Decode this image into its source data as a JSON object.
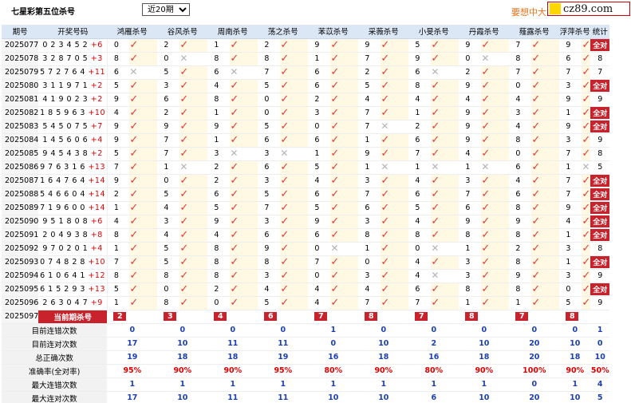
{
  "title": "七星彩第五位杀号",
  "period_select": {
    "value": "近20期",
    "options": [
      "近20期"
    ]
  },
  "ad_text": "要想中大",
  "logo_text": "cz89.com",
  "headers": [
    "期号",
    "开奖号码",
    "鸿雁杀号",
    "谷风杀号",
    "周南杀号",
    "荡之杀号",
    "苯苡杀号",
    "采薇杀号",
    "小旻杀号",
    "丹霞杀号",
    "薤露杀号",
    "浮萍杀号",
    "统计"
  ],
  "rows": [
    {
      "period": "2025077",
      "digits": "023452",
      "sum": "+6",
      "kills": [
        [
          "0",
          "ok"
        ],
        [
          "2",
          "ok"
        ],
        [
          "1",
          "ok"
        ],
        [
          "2",
          "ok"
        ],
        [
          "9",
          "ok"
        ],
        [
          "9",
          "ok"
        ],
        [
          "5",
          "ok"
        ],
        [
          "9",
          "ok"
        ],
        [
          "7",
          "ok"
        ],
        [
          "9",
          "ok"
        ]
      ],
      "stat": "全对"
    },
    {
      "period": "2025078",
      "digits": "328705",
      "sum": "+3",
      "kills": [
        [
          "8",
          "ok"
        ],
        [
          "0",
          "bad"
        ],
        [
          "8",
          "ok"
        ],
        [
          "8",
          "ok"
        ],
        [
          "1",
          "ok"
        ],
        [
          "7",
          "ok"
        ],
        [
          "9",
          "ok"
        ],
        [
          "0",
          "bad"
        ],
        [
          "8",
          "ok"
        ],
        [
          "6",
          "ok"
        ]
      ],
      "stat": "8"
    },
    {
      "period": "2025079",
      "digits": "572764",
      "sum": "+11",
      "kills": [
        [
          "6",
          "bad"
        ],
        [
          "5",
          "ok"
        ],
        [
          "6",
          "bad"
        ],
        [
          "7",
          "ok"
        ],
        [
          "6",
          "ok"
        ],
        [
          "2",
          "ok"
        ],
        [
          "6",
          "bad"
        ],
        [
          "2",
          "ok"
        ],
        [
          "7",
          "ok"
        ],
        [
          "7",
          "ok"
        ]
      ],
      "stat": "7"
    },
    {
      "period": "2025080",
      "digits": "311971",
      "sum": "+2",
      "kills": [
        [
          "5",
          "ok"
        ],
        [
          "3",
          "ok"
        ],
        [
          "4",
          "ok"
        ],
        [
          "5",
          "ok"
        ],
        [
          "6",
          "ok"
        ],
        [
          "5",
          "ok"
        ],
        [
          "8",
          "ok"
        ],
        [
          "9",
          "ok"
        ],
        [
          "0",
          "ok"
        ],
        [
          "3",
          "ok"
        ]
      ],
      "stat": "全对"
    },
    {
      "period": "2025081",
      "digits": "419023",
      "sum": "+2",
      "kills": [
        [
          "9",
          "ok"
        ],
        [
          "6",
          "ok"
        ],
        [
          "8",
          "ok"
        ],
        [
          "0",
          "ok"
        ],
        [
          "2",
          "ok"
        ],
        [
          "4",
          "ok"
        ],
        [
          "4",
          "ok"
        ],
        [
          "4",
          "ok"
        ],
        [
          "4",
          "ok"
        ],
        [
          "9",
          "ok"
        ]
      ],
      "stat": "9"
    },
    {
      "period": "2025082",
      "digits": "185963",
      "sum": "+10",
      "kills": [
        [
          "4",
          "ok"
        ],
        [
          "2",
          "ok"
        ],
        [
          "1",
          "ok"
        ],
        [
          "0",
          "ok"
        ],
        [
          "3",
          "ok"
        ],
        [
          "7",
          "ok"
        ],
        [
          "1",
          "ok"
        ],
        [
          "9",
          "ok"
        ],
        [
          "3",
          "ok"
        ],
        [
          "1",
          "ok"
        ]
      ],
      "stat": "全对"
    },
    {
      "period": "2025083",
      "digits": "545075",
      "sum": "+7",
      "kills": [
        [
          "9",
          "ok"
        ],
        [
          "9",
          "ok"
        ],
        [
          "9",
          "ok"
        ],
        [
          "5",
          "ok"
        ],
        [
          "0",
          "ok"
        ],
        [
          "7",
          "bad"
        ],
        [
          "2",
          "ok"
        ],
        [
          "9",
          "ok"
        ],
        [
          "4",
          "ok"
        ],
        [
          "9",
          "ok"
        ]
      ],
      "stat": "全对"
    },
    {
      "period": "2025084",
      "digits": "145606",
      "sum": "+4",
      "kills": [
        [
          "9",
          "ok"
        ],
        [
          "7",
          "ok"
        ],
        [
          "1",
          "ok"
        ],
        [
          "6",
          "ok"
        ],
        [
          "6",
          "ok"
        ],
        [
          "1",
          "ok"
        ],
        [
          "6",
          "ok"
        ],
        [
          "9",
          "ok"
        ],
        [
          "8",
          "ok"
        ],
        [
          "3",
          "ok"
        ]
      ],
      "stat": "9"
    },
    {
      "period": "2025085",
      "digits": "945438",
      "sum": "+2",
      "kills": [
        [
          "5",
          "ok"
        ],
        [
          "7",
          "ok"
        ],
        [
          "3",
          "bad"
        ],
        [
          "3",
          "bad"
        ],
        [
          "1",
          "ok"
        ],
        [
          "9",
          "ok"
        ],
        [
          "7",
          "ok"
        ],
        [
          "4",
          "ok"
        ],
        [
          "0",
          "ok"
        ],
        [
          "7",
          "ok"
        ]
      ],
      "stat": "8"
    },
    {
      "period": "2025086",
      "digits": "976316",
      "sum": "+13",
      "kills": [
        [
          "7",
          "ok"
        ],
        [
          "1",
          "bad"
        ],
        [
          "2",
          "ok"
        ],
        [
          "6",
          "ok"
        ],
        [
          "5",
          "ok"
        ],
        [
          "1",
          "bad"
        ],
        [
          "1",
          "bad"
        ],
        [
          "1",
          "bad"
        ],
        [
          "6",
          "ok"
        ],
        [
          "1",
          "bad"
        ]
      ],
      "stat": "5"
    },
    {
      "period": "2025087",
      "digits": "164764",
      "sum": "+14",
      "kills": [
        [
          "9",
          "ok"
        ],
        [
          "0",
          "ok"
        ],
        [
          "2",
          "ok"
        ],
        [
          "3",
          "ok"
        ],
        [
          "4",
          "ok"
        ],
        [
          "3",
          "ok"
        ],
        [
          "4",
          "ok"
        ],
        [
          "3",
          "ok"
        ],
        [
          "4",
          "ok"
        ],
        [
          "7",
          "ok"
        ]
      ],
      "stat": "全对"
    },
    {
      "period": "2025088",
      "digits": "546604",
      "sum": "+14",
      "kills": [
        [
          "2",
          "ok"
        ],
        [
          "5",
          "ok"
        ],
        [
          "6",
          "ok"
        ],
        [
          "5",
          "ok"
        ],
        [
          "6",
          "ok"
        ],
        [
          "7",
          "ok"
        ],
        [
          "6",
          "ok"
        ],
        [
          "7",
          "ok"
        ],
        [
          "6",
          "ok"
        ],
        [
          "7",
          "ok"
        ]
      ],
      "stat": "全对"
    },
    {
      "period": "2025089",
      "digits": "719600",
      "sum": "+14",
      "kills": [
        [
          "1",
          "ok"
        ],
        [
          "4",
          "ok"
        ],
        [
          "5",
          "ok"
        ],
        [
          "7",
          "ok"
        ],
        [
          "5",
          "ok"
        ],
        [
          "6",
          "ok"
        ],
        [
          "5",
          "ok"
        ],
        [
          "6",
          "ok"
        ],
        [
          "8",
          "ok"
        ],
        [
          "9",
          "ok"
        ]
      ],
      "stat": "全对"
    },
    {
      "period": "2025090",
      "digits": "951808",
      "sum": "+6",
      "kills": [
        [
          "4",
          "ok"
        ],
        [
          "3",
          "ok"
        ],
        [
          "9",
          "ok"
        ],
        [
          "3",
          "ok"
        ],
        [
          "9",
          "ok"
        ],
        [
          "3",
          "ok"
        ],
        [
          "4",
          "ok"
        ],
        [
          "9",
          "ok"
        ],
        [
          "9",
          "ok"
        ],
        [
          "4",
          "ok"
        ]
      ],
      "stat": "全对"
    },
    {
      "period": "2025091",
      "digits": "204938",
      "sum": "+8",
      "kills": [
        [
          "8",
          "ok"
        ],
        [
          "4",
          "ok"
        ],
        [
          "4",
          "ok"
        ],
        [
          "6",
          "ok"
        ],
        [
          "6",
          "ok"
        ],
        [
          "8",
          "ok"
        ],
        [
          "8",
          "ok"
        ],
        [
          "8",
          "ok"
        ],
        [
          "8",
          "ok"
        ],
        [
          "1",
          "ok"
        ]
      ],
      "stat": "全对"
    },
    {
      "period": "2025092",
      "digits": "970201",
      "sum": "+4",
      "kills": [
        [
          "1",
          "ok"
        ],
        [
          "5",
          "ok"
        ],
        [
          "8",
          "ok"
        ],
        [
          "9",
          "ok"
        ],
        [
          "0",
          "bad"
        ],
        [
          "1",
          "ok"
        ],
        [
          "0",
          "bad"
        ],
        [
          "1",
          "ok"
        ],
        [
          "2",
          "ok"
        ],
        [
          "3",
          "ok"
        ]
      ],
      "stat": "8"
    },
    {
      "period": "2025093",
      "digits": "074828",
      "sum": "+10",
      "kills": [
        [
          "7",
          "ok"
        ],
        [
          "5",
          "ok"
        ],
        [
          "8",
          "ok"
        ],
        [
          "8",
          "ok"
        ],
        [
          "7",
          "ok"
        ],
        [
          "0",
          "ok"
        ],
        [
          "4",
          "ok"
        ],
        [
          "3",
          "ok"
        ],
        [
          "8",
          "ok"
        ],
        [
          "1",
          "ok"
        ]
      ],
      "stat": "全对"
    },
    {
      "period": "2025094",
      "digits": "610641",
      "sum": "+12",
      "kills": [
        [
          "8",
          "ok"
        ],
        [
          "8",
          "ok"
        ],
        [
          "8",
          "ok"
        ],
        [
          "3",
          "ok"
        ],
        [
          "0",
          "ok"
        ],
        [
          "3",
          "ok"
        ],
        [
          "4",
          "bad"
        ],
        [
          "3",
          "ok"
        ],
        [
          "9",
          "ok"
        ],
        [
          "3",
          "ok"
        ]
      ],
      "stat": "9"
    },
    {
      "period": "2025095",
      "digits": "615293",
      "sum": "+13",
      "kills": [
        [
          "5",
          "ok"
        ],
        [
          "0",
          "ok"
        ],
        [
          "2",
          "ok"
        ],
        [
          "4",
          "ok"
        ],
        [
          "4",
          "ok"
        ],
        [
          "4",
          "ok"
        ],
        [
          "6",
          "ok"
        ],
        [
          "8",
          "ok"
        ],
        [
          "8",
          "ok"
        ],
        [
          "0",
          "ok"
        ]
      ],
      "stat": "全对"
    },
    {
      "period": "2025096",
      "digits": "263047",
      "sum": "+9",
      "kills": [
        [
          "1",
          "ok"
        ],
        [
          "8",
          "ok"
        ],
        [
          "0",
          "ok"
        ],
        [
          "5",
          "ok"
        ],
        [
          "4",
          "ok"
        ],
        [
          "7",
          "ok"
        ],
        [
          "7",
          "ok"
        ],
        [
          "1",
          "ok"
        ],
        [
          "1",
          "ok"
        ],
        [
          "5",
          "ok"
        ]
      ],
      "stat": "9"
    }
  ],
  "current": {
    "period": "2025097",
    "label": "当前期杀号",
    "picks": [
      "2",
      "3",
      "4",
      "6",
      "7",
      "8",
      "7",
      "8",
      "7",
      "8"
    ]
  },
  "summary": [
    {
      "label": "目前连错次数",
      "values": [
        "0",
        "0",
        "0",
        "0",
        "1",
        "0",
        "0",
        "0",
        "0",
        "0",
        "1"
      ],
      "kind": "num"
    },
    {
      "label": "目前连对次数",
      "values": [
        "17",
        "10",
        "11",
        "11",
        "0",
        "10",
        "2",
        "10",
        "20",
        "10",
        "0"
      ],
      "kind": "num"
    },
    {
      "label": "总正确次数",
      "values": [
        "19",
        "18",
        "18",
        "19",
        "16",
        "18",
        "16",
        "18",
        "20",
        "18",
        "10"
      ],
      "kind": "num"
    },
    {
      "label": "准确率(全对率)",
      "values": [
        "95%",
        "90%",
        "90%",
        "95%",
        "80%",
        "90%",
        "80%",
        "90%",
        "100%",
        "90%",
        "50%"
      ],
      "kind": "pct"
    },
    {
      "label": "最大连错次数",
      "values": [
        "1",
        "1",
        "1",
        "1",
        "1",
        "1",
        "1",
        "1",
        "0",
        "1",
        "4"
      ],
      "kind": "num"
    },
    {
      "label": "最大连对次数",
      "values": [
        "17",
        "10",
        "11",
        "11",
        "10",
        "10",
        "6",
        "10",
        "20",
        "10",
        "5"
      ],
      "kind": "num"
    }
  ],
  "icons": {
    "ok": "red-check-icon",
    "bad": "gray-cross-icon"
  }
}
